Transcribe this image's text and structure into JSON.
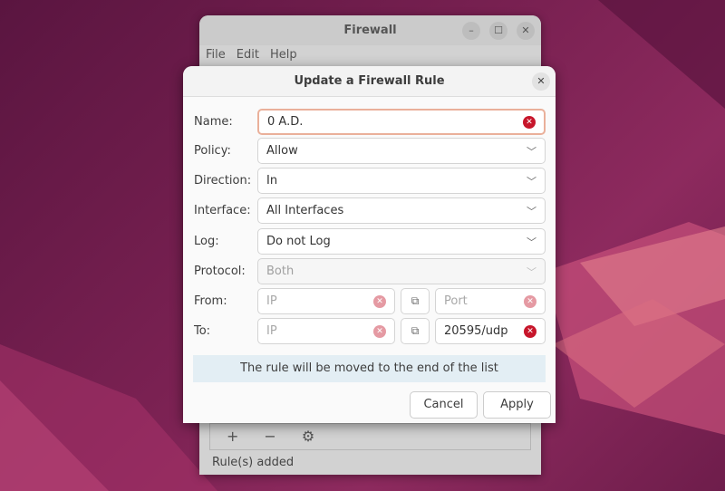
{
  "main_window": {
    "title": "Firewall",
    "menu": [
      "File",
      "Edit",
      "Help"
    ],
    "toolbar": {
      "add": "+",
      "remove": "−",
      "settings": "⚙"
    },
    "status": "Rule(s) added"
  },
  "dialog": {
    "title": "Update a Firewall Rule",
    "labels": {
      "name": "Name:",
      "policy": "Policy:",
      "direction": "Direction:",
      "interface": "Interface:",
      "log": "Log:",
      "protocol": "Protocol:",
      "from": "From:",
      "to": "To:"
    },
    "name_value": "0 A.D.",
    "policy": "Allow",
    "direction": "In",
    "interface": "All Interfaces",
    "log": "Do not Log",
    "protocol": "Both",
    "from_ip_placeholder": "IP",
    "from_port_placeholder": "Port",
    "to_ip_placeholder": "IP",
    "to_port_value": "20595/udp",
    "info": "The rule will be moved to the end of the list",
    "cancel": "Cancel",
    "apply": "Apply"
  },
  "colors": {
    "accent": "#c7162b",
    "focus": "#eab09a"
  }
}
